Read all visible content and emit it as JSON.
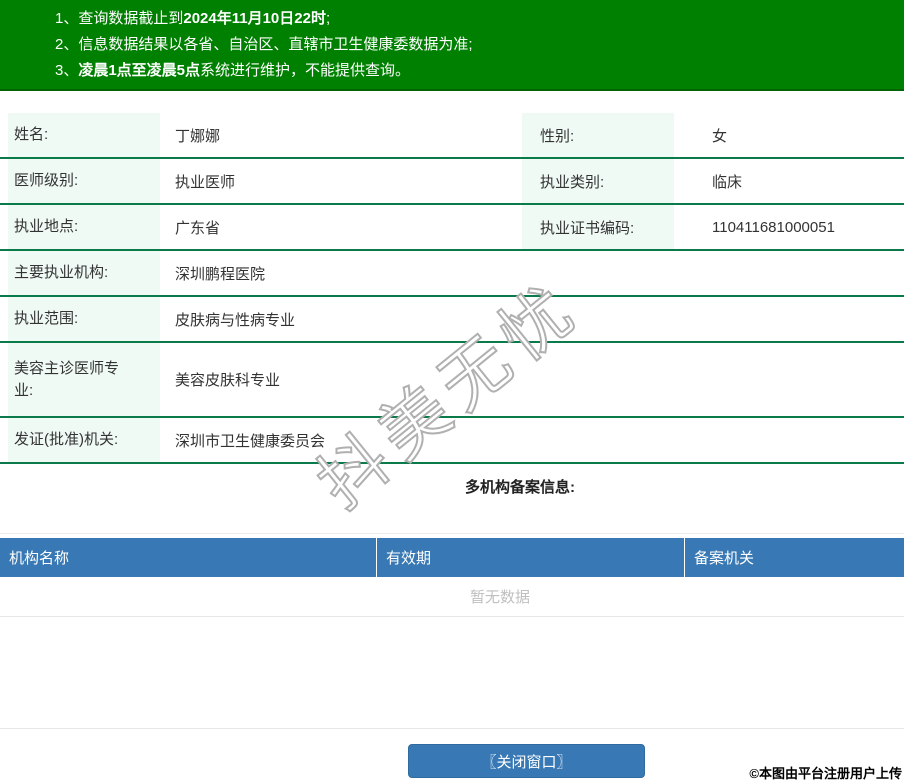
{
  "banner": {
    "bg_color": "#008000",
    "notices": [
      {
        "num": "1、",
        "pre": "查询数据截止到",
        "bold": "2024年11月10日22时",
        "post": ";"
      },
      {
        "num": "2、",
        "pre": "信息数据结果以各省、自治区、直辖市卫生健康委数据为准;",
        "bold": "",
        "post": ""
      },
      {
        "num": "3、",
        "pre": "",
        "bold": "凌晨1点至凌晨5点",
        "post": "系统进行维护，不能提供查询。"
      }
    ]
  },
  "info": {
    "label_bg_color": "#f0faf4",
    "row_border_color": "#0b7a4a",
    "rows": [
      {
        "label": "姓名:",
        "value": "丁娜娜",
        "label2": "性别:",
        "value2": "女"
      },
      {
        "label": "医师级别:",
        "value": "执业医师",
        "label2": "执业类别:",
        "value2": "临床"
      },
      {
        "label": "执业地点:",
        "value": "广东省",
        "label2": "执业证书编码:",
        "value2": "110411681000051"
      },
      {
        "label": "主要执业机构:",
        "value": "深圳鹏程医院"
      },
      {
        "label": "执业范围:",
        "value": "皮肤病与性病专业"
      },
      {
        "label": "美容主诊医师专\n业:",
        "value": "美容皮肤科专业"
      },
      {
        "label": "发证(批准)机关:",
        "value": "深圳市卫生健康委员会"
      }
    ]
  },
  "org_section": {
    "title": "多机构备案信息:",
    "header_bg_color": "#3878b4",
    "headers": [
      "机构名称",
      "有效期",
      "备案机关"
    ],
    "empty_text": "暂无数据"
  },
  "footer": {
    "close_button_label": "〖关闭窗口〗",
    "button_color": "#3878b4"
  },
  "watermark_text": "抖美无忧",
  "upload_caption": "©本图由平台注册用户上传"
}
